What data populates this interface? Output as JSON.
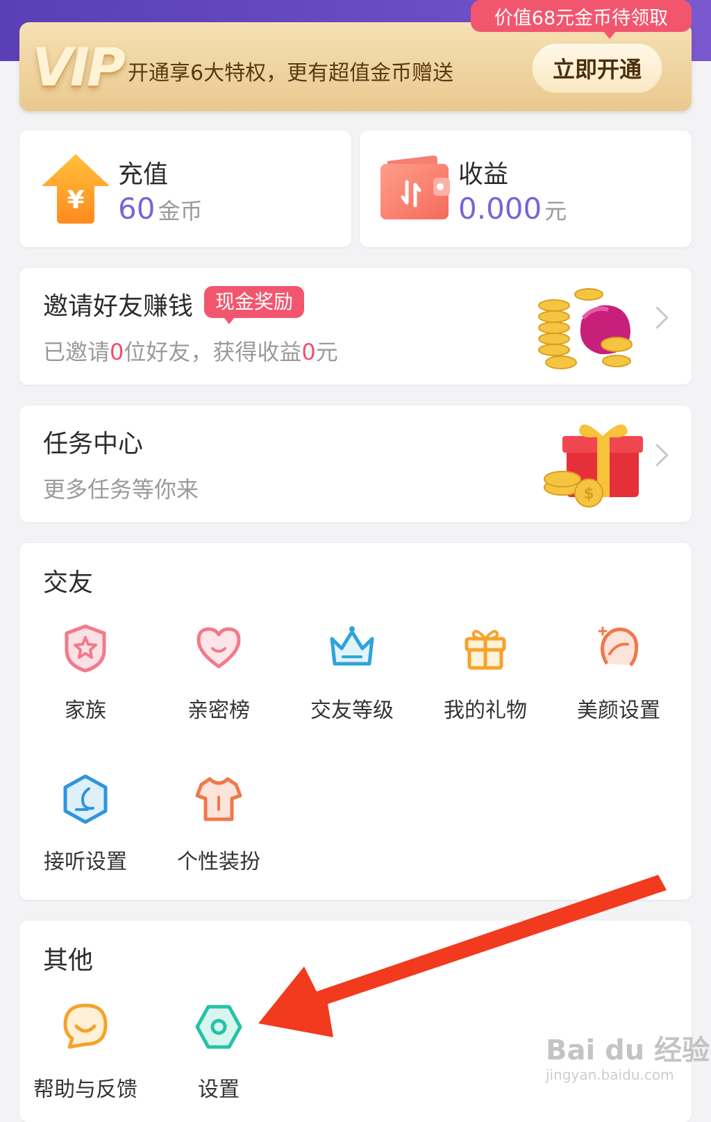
{
  "vip": {
    "logo": "VIP",
    "text": "开通享6大特权，更有超值金币赠送",
    "button": "立即开通",
    "tag": "价值68元金币待领取"
  },
  "wallet": {
    "recharge": {
      "title": "充值",
      "value": "60",
      "unit": "金币"
    },
    "income": {
      "title": "收益",
      "value": "0.000",
      "unit": "元"
    }
  },
  "invite": {
    "title": "邀请好友赚钱",
    "tag": "现金奖励",
    "sub_prefix": "已邀请",
    "invited": "0",
    "sub_middle": "位好友，获得收益",
    "earned": "0",
    "sub_suffix": "元"
  },
  "task": {
    "title": "任务中心",
    "sub": "更多任务等你来"
  },
  "social": {
    "title": "交友",
    "items": [
      {
        "label": "家族",
        "icon": "family-shield-icon"
      },
      {
        "label": "亲密榜",
        "icon": "heart-icon"
      },
      {
        "label": "交友等级",
        "icon": "crown-icon"
      },
      {
        "label": "我的礼物",
        "icon": "gift-icon"
      },
      {
        "label": "美颜设置",
        "icon": "beauty-face-icon"
      },
      {
        "label": "接听设置",
        "icon": "phone-hexagon-icon"
      },
      {
        "label": "个性装扮",
        "icon": "tshirt-icon"
      }
    ]
  },
  "other": {
    "title": "其他",
    "items": [
      {
        "label": "帮助与反馈",
        "icon": "chat-bubble-icon"
      },
      {
        "label": "设置",
        "icon": "settings-hexagon-icon"
      }
    ]
  },
  "watermark": {
    "brand": "Bai du 经验",
    "url": "jingyan.baidu.com"
  },
  "colors": {
    "accent": "#7a63d8",
    "tag_red": "#f2566e",
    "annotation_arrow": "#f23a1e"
  }
}
